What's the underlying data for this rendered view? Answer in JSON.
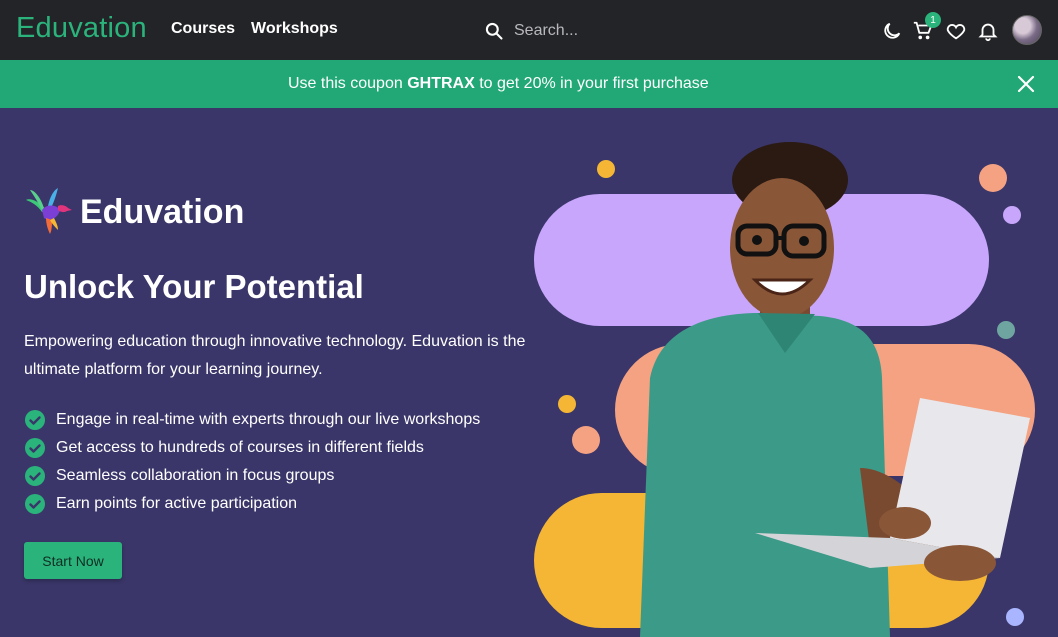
{
  "header": {
    "brand": "Eduvation",
    "nav": {
      "courses": "Courses",
      "workshops": "Workshops"
    },
    "search": {
      "placeholder": "Search..."
    },
    "icons": [
      "moon-icon",
      "cart-icon",
      "heart-icon",
      "bell-icon"
    ],
    "cart_count": "1"
  },
  "coupon": {
    "prefix": "Use this coupon ",
    "code": "GHTRAX",
    "suffix": " to get 20% in your first purchase"
  },
  "hero": {
    "brand": "Eduvation",
    "title": "Unlock Your Potential",
    "description": "Empowering education through innovative technology. Eduvation is the ultimate platform for your learning journey.",
    "features": [
      "Engage in real-time with experts through our live workshops",
      "Get access to hundreds of courses in different fields",
      "Seamless collaboration in focus groups",
      "Earn points for active participation"
    ],
    "cta": "Start Now"
  },
  "colors": {
    "accent": "#2bb37c",
    "topbar": "#232427",
    "coupon_bg": "#21a876",
    "hero_bg": "#3a3669",
    "pill_purple": "#c7a6fb",
    "pill_peach": "#f4a282",
    "pill_yellow": "#f4b634"
  }
}
